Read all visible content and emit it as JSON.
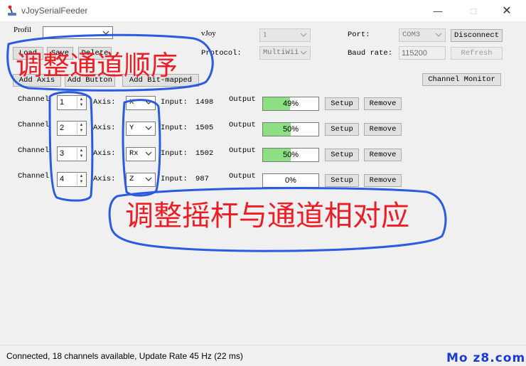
{
  "window": {
    "title": "vJoySerialFeeder",
    "controls": [
      "minimize",
      "maximize",
      "close"
    ]
  },
  "toolbar": {
    "profile_label": "Profil",
    "profile_value": "",
    "load_label": "Load",
    "save_label": "Save",
    "delete_label": "Delete",
    "vjoy_label": "vJoy",
    "vjoy_value": "1",
    "protocol_label": "Protocol:",
    "protocol_value": "MultiWii",
    "port_label": "Port:",
    "port_value": "COM3",
    "disconnect_label": "Disconnect",
    "baud_label": "Baud rate:",
    "baud_value": "115200",
    "refresh_label": "Refresh",
    "add_axis_label": "Add Axis",
    "add_button_label": "Add Button",
    "add_bitmapped_label": "Add Bit-mapped",
    "channel_monitor_label": "Channel Monitor"
  },
  "mappings": [
    {
      "channel_label": "Channel",
      "channel": "1",
      "axis_label": "Axis:",
      "axis": "X",
      "input_label": "Input:",
      "input": "1498",
      "output_label": "Output",
      "output": "49%",
      "output_fraction": 0.49,
      "setup_label": "Setup",
      "remove_label": "Remove"
    },
    {
      "channel_label": "Channel",
      "channel": "2",
      "axis_label": "Axis:",
      "axis": "Y",
      "input_label": "Input:",
      "input": "1505",
      "output_label": "Output",
      "output": "50%",
      "output_fraction": 0.5,
      "setup_label": "Setup",
      "remove_label": "Remove"
    },
    {
      "channel_label": "Channel",
      "channel": "3",
      "axis_label": "Axis:",
      "axis": "Rx",
      "input_label": "Input:",
      "input": "1502",
      "output_label": "Output",
      "output": "50%",
      "output_fraction": 0.5,
      "setup_label": "Setup",
      "remove_label": "Remove"
    },
    {
      "channel_label": "Channel",
      "channel": "4",
      "axis_label": "Axis:",
      "axis": "Z",
      "input_label": "Input:",
      "input": "987",
      "output_label": "Output",
      "output": "0%",
      "output_fraction": 0.0,
      "setup_label": "Setup",
      "remove_label": "Remove"
    }
  ],
  "status": {
    "text": "Connected, 18 channels available, Update Rate 45 Hz (22 ms)"
  },
  "annotations": {
    "top_note": "调整通道顺序",
    "bottom_note": "调整摇杆与通道相对应",
    "watermark": "Mo z8.com"
  },
  "colors": {
    "annotation_text": "#ee1c24",
    "annotation_outline": "#2a5be0",
    "progress_fill": "#8ce083",
    "watermark": "#1a3bd6"
  },
  "icons": {
    "app": "joystick-icon",
    "dropdown": "chevron-down-icon",
    "spinner": "up-down-arrow-icon"
  }
}
